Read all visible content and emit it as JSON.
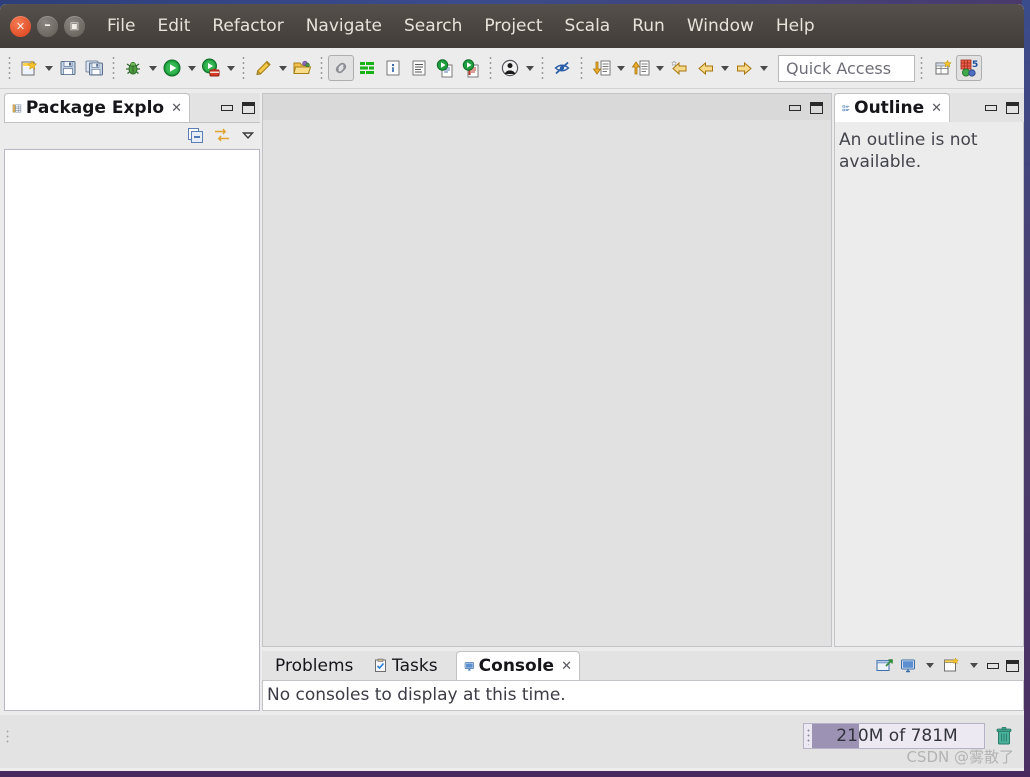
{
  "window": {
    "controls": {
      "close": "✕",
      "minimize": "–",
      "maximize": "▣"
    }
  },
  "menu": {
    "items": [
      {
        "label": "File",
        "name": "menu-file"
      },
      {
        "label": "Edit",
        "name": "menu-edit"
      },
      {
        "label": "Refactor",
        "name": "menu-refactor"
      },
      {
        "label": "Navigate",
        "name": "menu-navigate"
      },
      {
        "label": "Search",
        "name": "menu-search"
      },
      {
        "label": "Project",
        "name": "menu-project"
      },
      {
        "label": "Scala",
        "name": "menu-scala"
      },
      {
        "label": "Run",
        "name": "menu-run"
      },
      {
        "label": "Window",
        "name": "menu-window"
      },
      {
        "label": "Help",
        "name": "menu-help"
      }
    ]
  },
  "toolbar": {
    "icons": [
      "new-file-icon",
      "save-icon",
      "save-all-icon",
      "debug-icon",
      "run-icon",
      "run-external-tools-icon",
      "highlight-pen-icon",
      "open-folder-icon",
      "link-toggle-icon",
      "green-bars-icon",
      "info-icon",
      "document-icon",
      "run-scala-script-icon",
      "run-scala-worksheet-icon",
      "person-icon",
      "skip-breakpoints-icon",
      "next-annotation-icon",
      "previous-annotation-icon",
      "back-star-icon",
      "back-arrow-icon",
      "forward-arrow-icon"
    ],
    "quick_access": {
      "placeholder": "Quick Access",
      "value": ""
    },
    "perspectives": {
      "open_perspective": "open-perspective-icon",
      "active": "scala-perspective-icon"
    }
  },
  "package_explorer": {
    "tab_label": "Package Explo",
    "tab_icon": "package-explorer-icon",
    "close_glyph": "✕",
    "tools": [
      "collapse-all-icon",
      "link-with-editor-icon",
      "view-menu-icon"
    ],
    "content": ""
  },
  "editor": {
    "content": ""
  },
  "outline": {
    "tab_label": "Outline",
    "tab_icon": "outline-icon",
    "close_glyph": "✕",
    "message": "An outline is not available."
  },
  "console_stack": {
    "tabs": [
      {
        "label": "Problems",
        "icon": "problems-icon",
        "active": false,
        "closable": false
      },
      {
        "label": "Tasks",
        "icon": "tasks-icon",
        "active": false,
        "closable": false
      },
      {
        "label": "Console",
        "icon": "console-icon",
        "active": true,
        "closable": true
      }
    ],
    "close_glyph": "✕",
    "message": "No consoles to display at this time.",
    "tools": [
      "pin-console-icon",
      "display-console-icon",
      "open-console-icon"
    ]
  },
  "status_bar": {
    "heap": {
      "text": "210M of 781M",
      "used_mb": 210,
      "total_mb": 781,
      "percent": 27
    },
    "trash_icon": "trash-icon",
    "watermark": "CSDN @雾散了"
  },
  "colors": {
    "titlebar": "#4a4540",
    "toolbar_bg": "#ececec",
    "heap_fill": "#9b92b4",
    "close_button": "#e2512a",
    "accent_tab_text": "#15151a"
  }
}
